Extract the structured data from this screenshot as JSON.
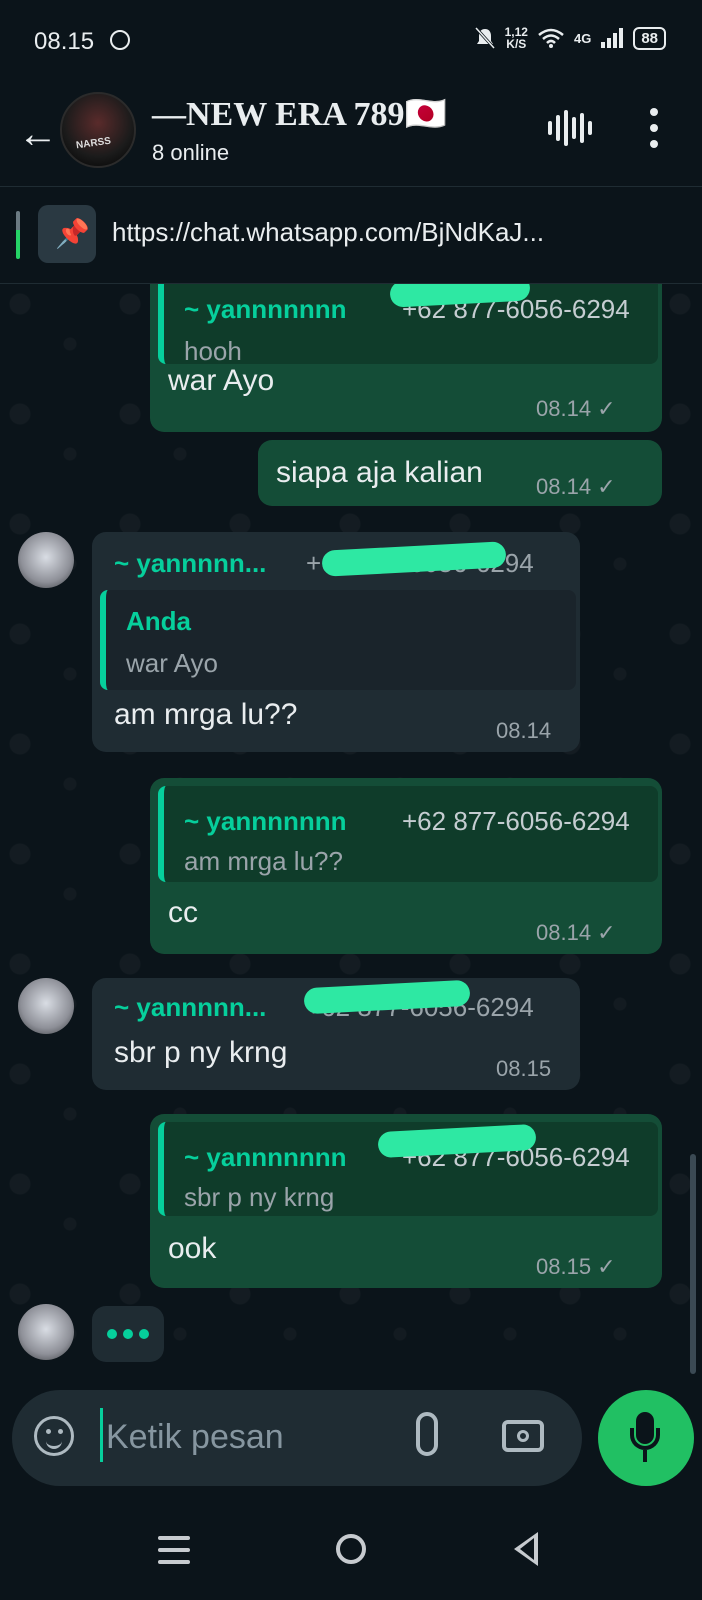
{
  "status_bar": {
    "time": "08.15",
    "net_speed_top": "1,12",
    "net_speed_bottom": "K/S",
    "network": "4G",
    "battery": "88"
  },
  "header": {
    "title": "—NEW ERA 789🇯🇵",
    "subtitle": "8 online",
    "avatar_tag": "NARSS"
  },
  "pinned": {
    "link": "https://chat.whatsapp.com/BjNdKaJ..."
  },
  "messages": [
    {
      "direction": "out",
      "quote_name": "~ yannnnnnn",
      "quote_phone": "+62 877-6056-6294",
      "quote_text": "hooh",
      "text": "war Ayo",
      "time": "08.14"
    },
    {
      "direction": "out",
      "text": "siapa aja kalian",
      "time": "08.14"
    },
    {
      "direction": "in",
      "sender": "~ yannnnn...",
      "sender_phone": "+62 877-6056-6294",
      "quote_name": "Anda",
      "quote_text": "war Ayo",
      "text": "am mrga lu??",
      "time": "08.14"
    },
    {
      "direction": "out",
      "quote_name": "~ yannnnnnn",
      "quote_phone": "+62 877-6056-6294",
      "quote_text": "am mrga lu??",
      "text": "cc",
      "time": "08.14"
    },
    {
      "direction": "in",
      "sender": "~ yannnnn...",
      "sender_phone": "+62 877-6056-6294",
      "text": "sbr p ny krng",
      "time": "08.15"
    },
    {
      "direction": "out",
      "quote_name": "~ yannnnnnn",
      "quote_phone": "+62 877-6056-6294",
      "quote_text": "sbr p ny krng",
      "text": "ook",
      "time": "08.15"
    }
  ],
  "composer": {
    "placeholder": "Ketik pesan"
  },
  "icons": {
    "back": "arrow-left-icon",
    "voice_chat": "audio-waveform-icon",
    "menu": "more-vertical-icon",
    "pin": "pin-icon",
    "emoji": "sticker-smile-icon",
    "attach": "paperclip-icon",
    "camera": "camera-icon",
    "mic": "microphone-icon",
    "read_status": "check-icon"
  },
  "colors": {
    "background": "#0b141a",
    "outgoing_bubble": "#144d37",
    "incoming_bubble": "#1f2c33",
    "accent": "#06cf9c",
    "mic_button": "#21c063"
  },
  "tick_glyph": "✓"
}
